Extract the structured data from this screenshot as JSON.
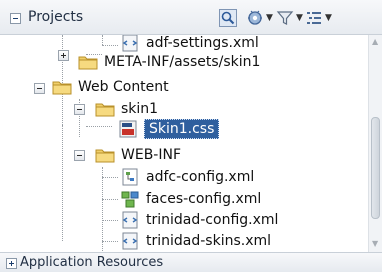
{
  "header": {
    "title": "Projects",
    "icons": [
      "search-icon",
      "project-settings-icon",
      "filter-icon",
      "options-icon"
    ]
  },
  "tree": {
    "items": [
      {
        "label": "adf-settings.xml",
        "icon": "xml-file-icon"
      },
      {
        "label": "META-INF/assets/skin1",
        "icon": "folder-icon"
      },
      {
        "label": "Web Content",
        "icon": "folder-icon"
      },
      {
        "label": "skin1",
        "icon": "folder-icon"
      },
      {
        "label": "Skin1.css",
        "icon": "css-file-icon",
        "selected": true
      },
      {
        "label": "WEB-INF",
        "icon": "folder-icon"
      },
      {
        "label": "adfc-config.xml",
        "icon": "adfc-config-icon"
      },
      {
        "label": "faces-config.xml",
        "icon": "faces-config-icon"
      },
      {
        "label": "trinidad-config.xml",
        "icon": "xml-file-icon"
      },
      {
        "label": "trinidad-skins.xml",
        "icon": "xml-file-icon"
      }
    ]
  },
  "footer": {
    "title": "Application Resources"
  },
  "colors": {
    "selection": "#2f5f9e",
    "folder": "#e8c25a",
    "header_bg": "#e7ebf0"
  }
}
